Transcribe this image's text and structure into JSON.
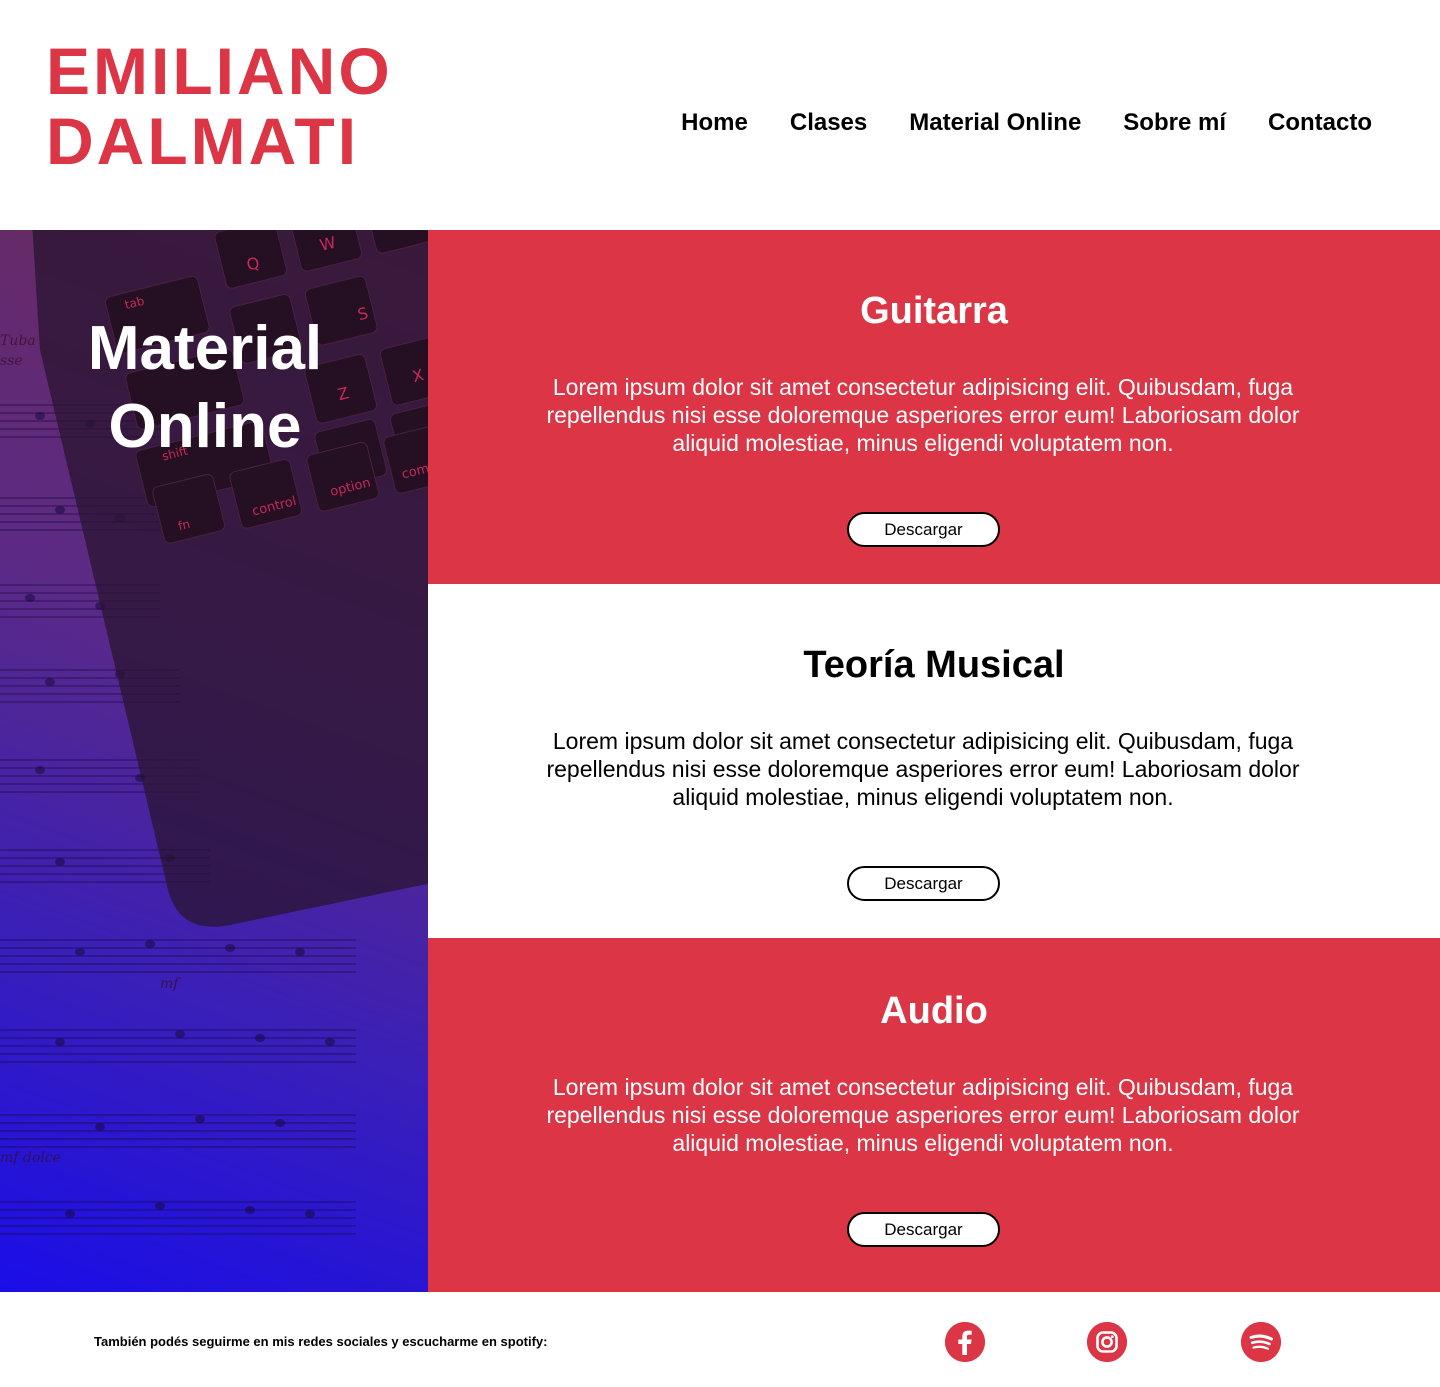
{
  "header": {
    "logo_line1": "EMILIANO",
    "logo_line2": "DALMATI",
    "nav": [
      "Home",
      "Clases",
      "Material Online",
      "Sobre mí",
      "Contacto"
    ]
  },
  "hero": {
    "title_line1": "Material",
    "title_line2": "Online"
  },
  "sections": [
    {
      "title": "Guitarra",
      "text": "Lorem ipsum dolor sit amet consectetur adipisicing elit. Quibusdam, fuga repellendus nisi esse doloremque asperiores error eum! Laboriosam dolor aliquid molestiae, minus eligendi voluptatem non.",
      "button": "Descargar"
    },
    {
      "title": "Teoría Musical",
      "text": "Lorem ipsum dolor sit amet consectetur adipisicing elit. Quibusdam, fuga repellendus nisi esse doloremque asperiores error eum! Laboriosam dolor aliquid molestiae, minus eligendi voluptatem non.",
      "button": "Descargar"
    },
    {
      "title": "Audio",
      "text": "Lorem ipsum dolor sit amet consectetur adipisicing elit. Quibusdam, fuga repellendus nisi esse doloremque asperiores error eum! Laboriosam dolor aliquid molestiae, minus eligendi voluptatem non.",
      "button": "Descargar"
    }
  ],
  "footer": {
    "text": "También podés seguirme en mis redes sociales y escucharme en spotify:",
    "icons": [
      "facebook-icon",
      "instagram-icon",
      "spotify-icon"
    ]
  },
  "colors": {
    "accent": "#dc3545"
  }
}
